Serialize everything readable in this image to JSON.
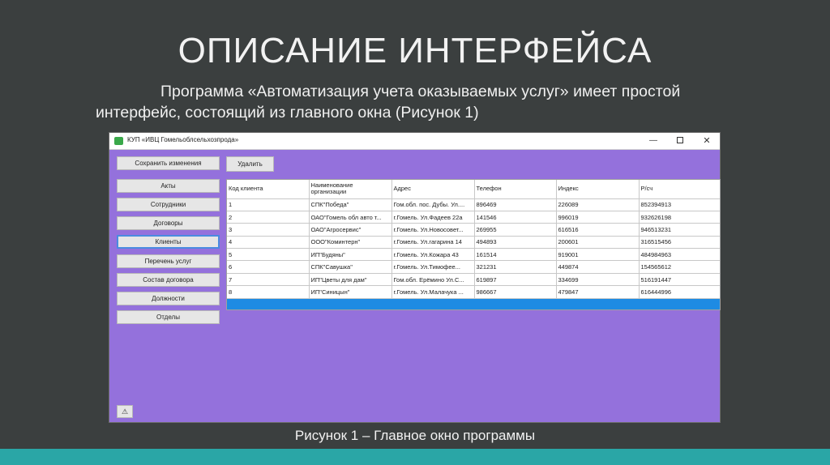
{
  "slide": {
    "title": "ОПИСАНИЕ ИНТЕРФЕЙСА",
    "line1": "Программа «Автоматизация учета оказываемых услуг» имеет простой",
    "line2": "интерфейс, состоящий из главного окна (Рисунок 1)",
    "caption": "Рисунок 1 – Главное окно программы"
  },
  "window": {
    "title": "КУП «ИВЦ Гомельоблсельхозпрода»",
    "minimize": "—",
    "close": "✕"
  },
  "toolbar": {
    "save_label": "Сохранить изменения",
    "delete_label": "Удалить"
  },
  "sidebar": {
    "items": [
      {
        "label": "Акты"
      },
      {
        "label": "Сотрудники"
      },
      {
        "label": "Договоры"
      },
      {
        "label": "Клиенты"
      },
      {
        "label": "Перечень услуг"
      },
      {
        "label": "Состав договора"
      },
      {
        "label": "Должности"
      },
      {
        "label": "Отделы"
      }
    ],
    "active": "Клиенты"
  },
  "table": {
    "columns": [
      "Код клиента",
      "Наименование организации",
      "Адрес",
      "Телефон",
      "Индекс",
      "Р/сч"
    ],
    "rows": [
      [
        "1",
        "СПК\"Победа\"",
        "Гом.обл. пос. Дубы. Ул....",
        "896469",
        "226089",
        "852394913"
      ],
      [
        "2",
        "ОАО\"Гомель обл авто т...",
        "г.Гомель. Ул.Фадеев 22а",
        "141546",
        "996019",
        "932626198"
      ],
      [
        "3",
        "ОАО\"Агросервис\"",
        "г.Гомель. Ул.Новосовет...",
        "269955",
        "616516",
        "946513231"
      ],
      [
        "4",
        "ООО\"Коминтерн\"",
        "г.Гомель. Ул.гагарина 14",
        "494893",
        "200601",
        "316515456"
      ],
      [
        "5",
        "ИП\"Будяны\"",
        "г.Гомель. Ул.Кожара 43",
        "161514",
        "919001",
        "484984963"
      ],
      [
        "6",
        "СПК\"Савушка\"",
        "г.Гомель. Ул.Тимофее...",
        "321231",
        "449874",
        "154565612"
      ],
      [
        "7",
        "ИП\"Цветы для дам\"",
        "Гом.обл. Ерёмино Ул.С...",
        "619897",
        "334699",
        "516191447"
      ],
      [
        "8",
        "ИП\"Синицын\"",
        "г.Гомель. Ул.Малачука ...",
        "986667",
        "479847",
        "616444996"
      ]
    ]
  },
  "status": {
    "warning_icon": "warning-icon",
    "warning_glyph": "⚠"
  },
  "colors": {
    "background": "#3b3f3f",
    "window_body": "#9471dc",
    "accent_bar": "#2aa6a6",
    "selected_row": "#1e8be3"
  }
}
